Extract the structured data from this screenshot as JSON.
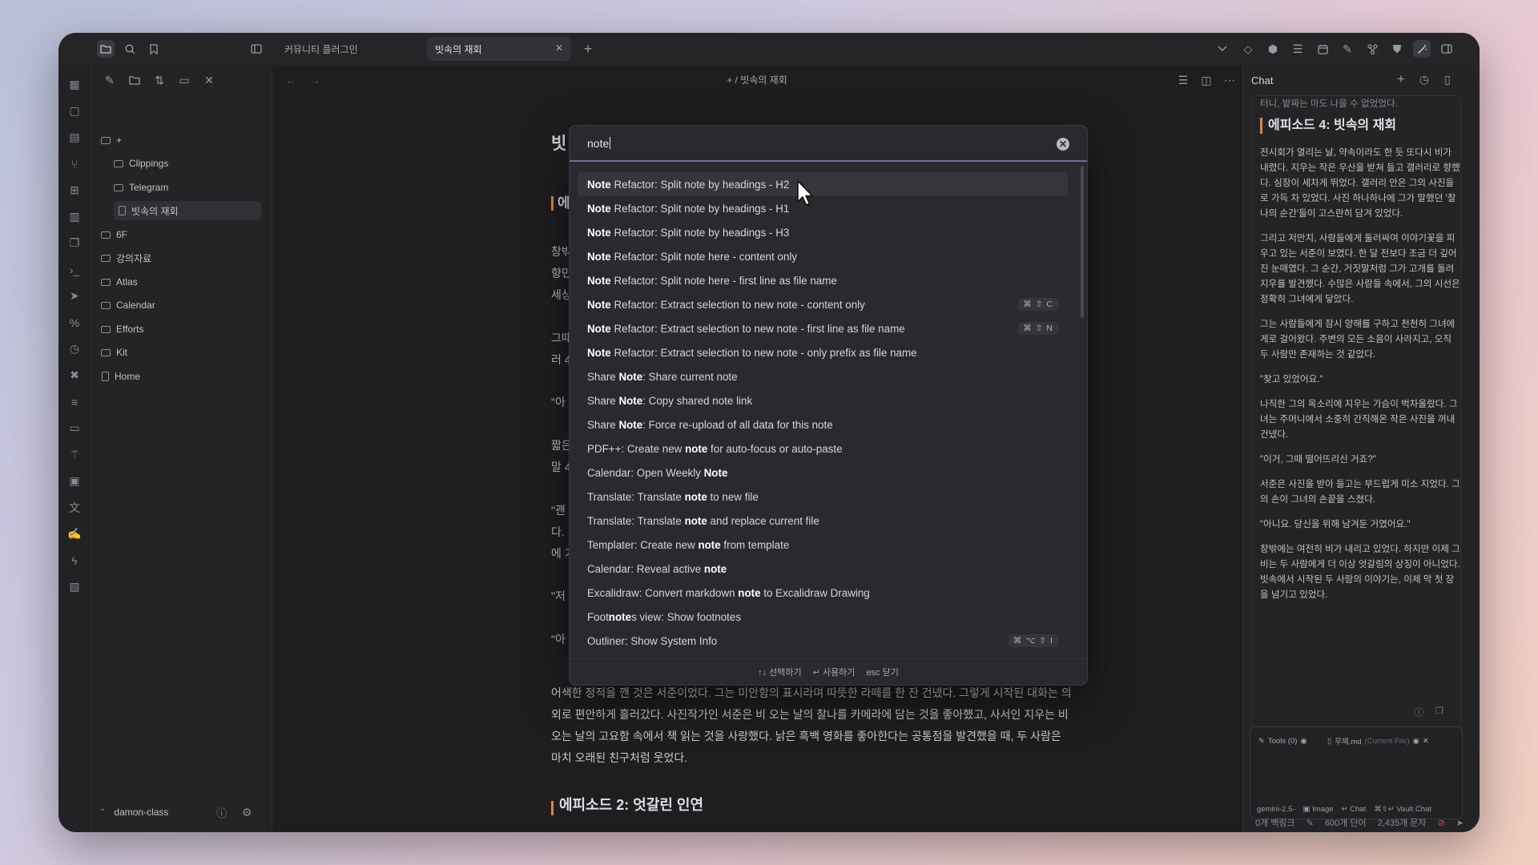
{
  "titlebar": {
    "tabs": [
      {
        "label": "커뮤니티 플러그인",
        "active": false
      },
      {
        "label": "빗속의 재회",
        "active": true
      }
    ],
    "close_tab": "✕",
    "new_tab": "+",
    "icons_left": [
      "folder-icon",
      "search-icon",
      "bookmark-icon",
      "sidebar-toggle-icon"
    ],
    "icons_right": [
      "chevron-down-icon",
      "tag-icon",
      "hexagon-icon",
      "list-icon",
      "calendar-icon",
      "edit-icon",
      "graph-icon",
      "shield-icon",
      "magic-wand-icon",
      "right-sidebar-icon"
    ]
  },
  "sidebar": {
    "tree": [
      {
        "label": "+",
        "type": "folder",
        "level": 0
      },
      {
        "label": "Clippings",
        "type": "folder",
        "level": 1
      },
      {
        "label": "Telegram",
        "type": "folder",
        "level": 1
      },
      {
        "label": "빗속의 재회",
        "type": "file",
        "level": 1,
        "active": true
      },
      {
        "label": "6F",
        "type": "folder",
        "level": 0
      },
      {
        "label": "강의자료",
        "type": "folder",
        "level": 0
      },
      {
        "label": "Atlas",
        "type": "folder",
        "level": 0
      },
      {
        "label": "Calendar",
        "type": "folder",
        "level": 0
      },
      {
        "label": "Efforts",
        "type": "folder",
        "level": 0
      },
      {
        "label": "Kit",
        "type": "folder",
        "level": 0
      },
      {
        "label": "Home",
        "type": "file",
        "level": 0
      }
    ],
    "vault_name": "damon-class"
  },
  "editor": {
    "breadcrumb": "+ / 빗속의 재회",
    "fragments": [
      "빗",
      "에",
      "창밖",
      "향민",
      "세상",
      "그때",
      "러 4",
      "\"아",
      "짧은",
      "말 4",
      "\"괜",
      "다.",
      "에 기",
      "\"저",
      "\"아"
    ],
    "paragraph_lines": [
      "어색한 정적을 깬 것은 서준이었다. 그는 미안함의 표시라며 따뜻한 라떼를 한 잔 건넸다. 그렇게 시작된 대화는 의",
      "외로 편안하게 흘러갔다. 사진작가인 서준은 비 오는 날의 찰나를 카메라에 담는 것을 좋아했고, 사서인 지우는 비",
      "오는 날의 고요함 속에서 책 읽는 것을 사랑했다. 낡은 흑백 영화를 좋아한다는 공통점을 발견했을 때, 두 사람은",
      "마치 오래된 친구처럼 웃었다."
    ],
    "heading2": "에피소드 2: 엇갈린 인연"
  },
  "palette": {
    "query": "note",
    "clear_icon": "✕",
    "commands": [
      {
        "prefix": "",
        "bold": "Note",
        "rest": " Refactor: Split note by headings - H2",
        "hotkey": ""
      },
      {
        "prefix": "",
        "bold": "Note",
        "rest": " Refactor: Split note by headings - H1",
        "hotkey": ""
      },
      {
        "prefix": "",
        "bold": "Note",
        "rest": " Refactor: Split note by headings - H3",
        "hotkey": ""
      },
      {
        "prefix": "",
        "bold": "Note",
        "rest": " Refactor: Split note here - content only",
        "hotkey": ""
      },
      {
        "prefix": "",
        "bold": "Note",
        "rest": " Refactor: Split note here - first line as file name",
        "hotkey": ""
      },
      {
        "prefix": "",
        "bold": "Note",
        "rest": " Refactor: Extract selection to new note - content only",
        "hotkey": "⌘ ⇧ C"
      },
      {
        "prefix": "",
        "bold": "Note",
        "rest": " Refactor: Extract selection to new note - first line as file name",
        "hotkey": "⌘ ⇧ N"
      },
      {
        "prefix": "",
        "bold": "Note",
        "rest": " Refactor: Extract selection to new note - only prefix as file name",
        "hotkey": ""
      },
      {
        "prefix": "Share ",
        "bold": "Note",
        "rest": ": Share current note",
        "hotkey": ""
      },
      {
        "prefix": "Share ",
        "bold": "Note",
        "rest": ": Copy shared note link",
        "hotkey": ""
      },
      {
        "prefix": "Share ",
        "bold": "Note",
        "rest": ": Force re-upload of all data for this note",
        "hotkey": ""
      },
      {
        "prefix": "PDF++: Create new ",
        "bold": "note",
        "rest": " for auto-focus or auto-paste",
        "hotkey": ""
      },
      {
        "prefix": "Calendar: Open Weekly ",
        "bold": "Note",
        "rest": "",
        "hotkey": ""
      },
      {
        "prefix": "Translate: Translate ",
        "bold": "note",
        "rest": " to new file",
        "hotkey": ""
      },
      {
        "prefix": "Translate: Translate ",
        "bold": "note",
        "rest": " and replace current file",
        "hotkey": ""
      },
      {
        "prefix": "Templater: Create new ",
        "bold": "note",
        "rest": " from template",
        "hotkey": ""
      },
      {
        "prefix": "Calendar: Reveal active ",
        "bold": "note",
        "rest": "",
        "hotkey": ""
      },
      {
        "prefix": "Excalidraw: Convert markdown ",
        "bold": "note",
        "rest": " to Excalidraw Drawing",
        "hotkey": ""
      },
      {
        "prefix": "Foot",
        "bold": "note",
        "rest": "s view: Show footnotes",
        "hotkey": ""
      },
      {
        "prefix": "Outliner: Show System Info",
        "bold": "",
        "rest": "",
        "hotkey": "⌘ ⌥ ⇧ I"
      }
    ],
    "footer": [
      "↑↓ 선택하기",
      "↵ 사용하기",
      "esc 닫기"
    ]
  },
  "chat": {
    "title": "Chat",
    "top_fragment": "터니, 밭짜는 마도 나을 수 없었었다.",
    "heading": "에피소드 4: 빗속의 재회",
    "paragraphs": [
      "전시회가 열리는 날, 약속이라도 한 듯 또다시 비가 내렸다. 지우는 작은 우산을 받쳐 들고 갤러리로 향했다. 심장이 세차게 뛰었다. 갤러리 안은 그의 사진들로 가득 차 있었다. 사진 하나하나에 그가 말했던 '찰나의 순간'들이 고스란히 담겨 있었다.",
      "그리고 저만치, 사람들에게 둘러싸여 이야기꽃을 피우고 있는 서준이 보였다. 한 달 전보다 조금 더 깊어진 눈매였다. 그 순간, 거짓말처럼 그가 고개를 돌려 지우를 발견했다. 수많은 사람들 속에서, 그의 시선은 정확히 그녀에게 닿았다.",
      "그는 사람들에게 잠시 양해를 구하고 천천히 그녀에게로 걸어왔다. 주변의 모든 소음이 사라지고, 오직 두 사람만 존재하는 것 같았다.",
      "\"찾고 있었어요.\"",
      "나직한 그의 목소리에 지우는 가슴이 벅차올랐다. 그녀는 주머니에서 소중히 간직해온 작은 사진을 꺼내 건넸다.",
      "\"이거, 그때 떨어뜨리신 거죠?\"",
      "서준은 사진을 받아 들고는 부드럽게 미소 지었다. 그의 손이 그녀의 손끝을 스쳤다.",
      "\"아니요. 당신을 위해 남겨둔 거였어요.\"",
      "창밖에는 여전히 비가 내리고 있었다. 하지만 이제 그 비는 두 사람에게 더 이상 엇갈림의 상징이 아니었다. 빗속에서 시작된 두 사람의 이야기는, 이제 막 첫 장을 넘기고 있었다."
    ],
    "chips": {
      "tools": "Tools (0)",
      "file": "무제.md",
      "file_note": "(Current File)"
    },
    "footer": {
      "model": "gemini-2.5-",
      "image": "Image",
      "chat": "↵ Chat",
      "vault": "⌘⇧↵ Vault Chat"
    }
  },
  "statusbar": {
    "backlinks": "0개 백링크",
    "words": "600개 단어",
    "chars": "2,435개 문자"
  },
  "colors": {
    "accent": "#d9883a",
    "input_underline": "#6e6ea4",
    "bg": "#1e1e21"
  }
}
